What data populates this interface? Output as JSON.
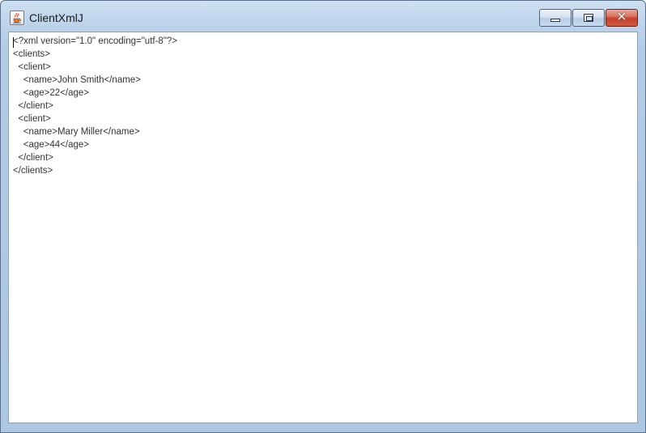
{
  "window": {
    "title": "ClientXmlJ",
    "icon": "java-cup-icon",
    "controls": {
      "minimize": "minimize-icon",
      "maximize": "maximize-icon",
      "close": "✕"
    }
  },
  "editor": {
    "lines": [
      "<?xml version=\"1.0\" encoding=\"utf-8\"?>",
      "<clients>",
      "  <client>",
      "    <name>John Smith</name>",
      "    <age>22</age>",
      "  </client>",
      "  <client>",
      "    <name>Mary Miller</name>",
      "    <age>44</age>",
      "  </client>",
      "</clients>"
    ]
  },
  "colors": {
    "titlebar": "#bcd3ea",
    "close_button": "#c5402b",
    "text": "#333333"
  }
}
